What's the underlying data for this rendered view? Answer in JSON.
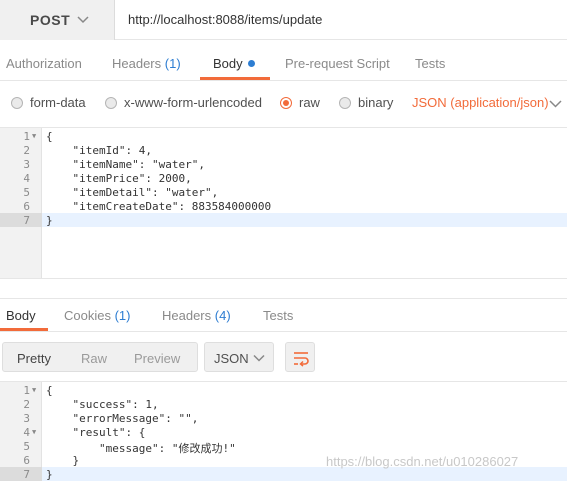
{
  "request": {
    "method": "POST",
    "url": "http://localhost:8088/items/update"
  },
  "request_tabs": [
    {
      "label": "Authorization",
      "count": ""
    },
    {
      "label": "Headers",
      "count": "(1)"
    },
    {
      "label": "Body",
      "count": ""
    },
    {
      "label": "Pre-request Script",
      "count": ""
    },
    {
      "label": "Tests",
      "count": ""
    }
  ],
  "body_types": {
    "form_data": "form-data",
    "urlencoded": "x-www-form-urlencoded",
    "raw": "raw",
    "binary": "binary",
    "content_type": "JSON (application/json)"
  },
  "request_body": {
    "line_numbers": [
      "1",
      "2",
      "3",
      "4",
      "5",
      "6",
      "7"
    ],
    "lines": [
      "{",
      "    \"itemId\": 4,",
      "    \"itemName\": \"water\",",
      "    \"itemPrice\": 2000,",
      "    \"itemDetail\": \"water\",",
      "    \"itemCreateDate\": 883584000000",
      "}"
    ]
  },
  "response_tabs": [
    {
      "label": "Body",
      "count": ""
    },
    {
      "label": "Cookies",
      "count": "(1)"
    },
    {
      "label": "Headers",
      "count": "(4)"
    },
    {
      "label": "Tests",
      "count": ""
    }
  ],
  "response_view": {
    "pretty": "Pretty",
    "raw": "Raw",
    "preview": "Preview",
    "format": "JSON"
  },
  "response_body": {
    "line_numbers": [
      "1",
      "2",
      "3",
      "4",
      "5",
      "6",
      "7"
    ],
    "lines": [
      "{",
      "    \"success\": 1,",
      "    \"errorMessage\": \"\",",
      "    \"result\": {",
      "        \"message\": \"修改成功!\"",
      "    }",
      "}"
    ]
  },
  "watermark": "https://blog.csdn.net/u010286027",
  "colors": {
    "accent": "#f26b3a",
    "link": "#2d7dd2"
  }
}
